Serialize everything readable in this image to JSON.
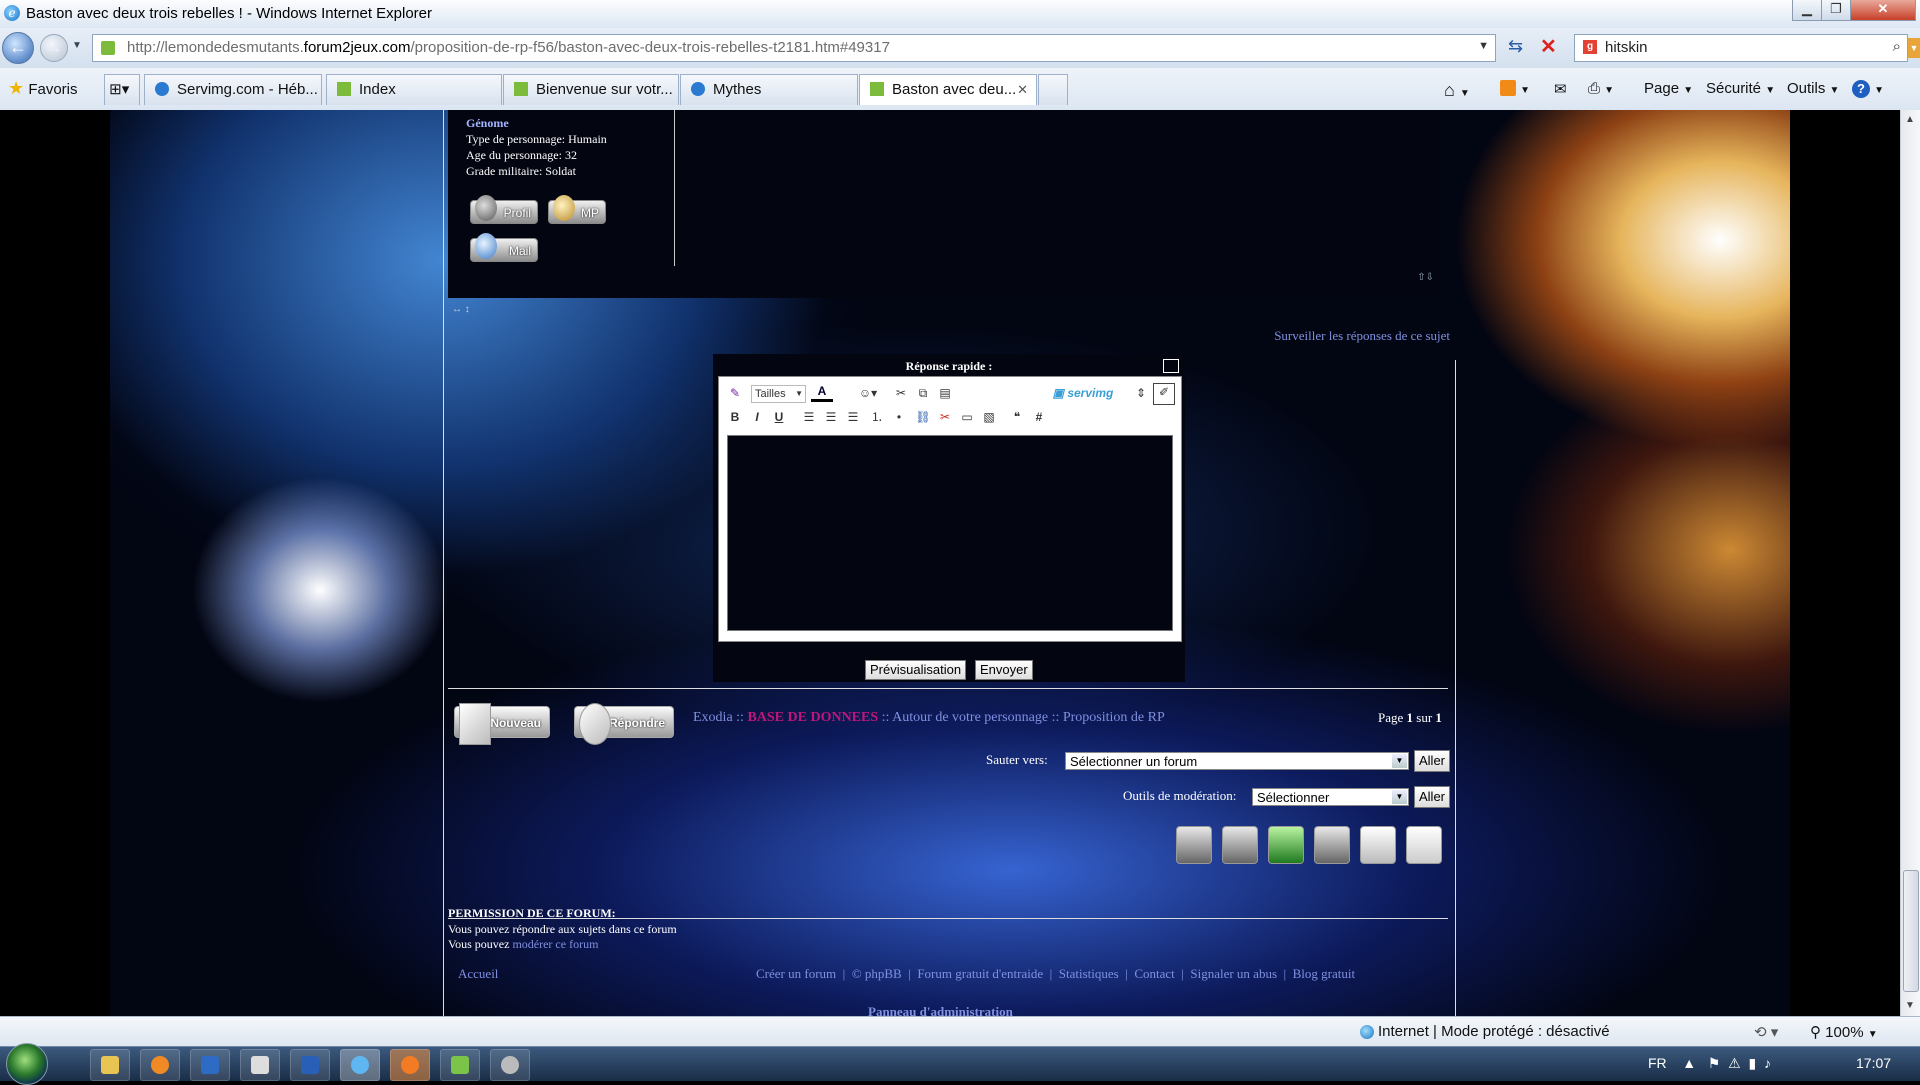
{
  "window": {
    "title": "Baston avec deux trois rebelles ! - Windows Internet Explorer"
  },
  "address": {
    "url_prefix": "http://lemondedesmutants.",
    "url_domain": "forum2jeux.com",
    "url_suffix": "/proposition-de-rp-f56/baston-avec-deux-trois-rebelles-t2181.htm#49317"
  },
  "search": {
    "value": "hitskin"
  },
  "favorites": {
    "label": "Favoris"
  },
  "tabs": [
    {
      "label": "Servimg.com - Héb...",
      "icon_color": "#2a7ad2"
    },
    {
      "label": "Index",
      "icon_color": "#7dbb3c"
    },
    {
      "label": "Bienvenue sur votr...",
      "icon_color": "#7dbb3c"
    },
    {
      "label": "Mythes",
      "icon_color": "#2a7ad2"
    },
    {
      "label": "Baston avec deu...",
      "icon_color": "#7dbb3c",
      "active": true
    }
  ],
  "toolbar": {
    "page": "Page",
    "security": "Sécurité",
    "tools": "Outils"
  },
  "post": {
    "field_name": "Génome",
    "type": "Type de personnage: Humain",
    "age": "Age du personnage: 32",
    "grade": "Grade militaire: Soldat",
    "btn_profile": "Profil",
    "btn_pm": "MP",
    "btn_mail": "Mail"
  },
  "watch_link": "Surveiller les réponses de ce sujet",
  "quick_reply": {
    "title": "Réponse rapide :",
    "size_label": "Tailles",
    "servimg": "servimg",
    "preview": "Prévisualisation",
    "send": "Envoyer"
  },
  "actions": {
    "new": "Nouveau",
    "reply": "Répondre"
  },
  "breadcrumb": {
    "items": [
      "Exodia",
      "BASE DE DONNEES",
      "Autour de votre personnage",
      "Proposition de RP"
    ],
    "separator": "::"
  },
  "pagination": {
    "prefix": "Page",
    "current": "1",
    "mid": "sur",
    "total": "1"
  },
  "jump": {
    "label": "Sauter vers:",
    "value": "Sélectionner un forum",
    "go": "Aller"
  },
  "moderation": {
    "label": "Outils de modération:",
    "value": "Sélectionner",
    "go": "Aller"
  },
  "permissions": {
    "title": "PERMISSION DE CE FORUM:",
    "line1": "Vous pouvez répondre aux sujets dans ce forum",
    "line2_prefix": "Vous pouvez",
    "line2_link": "modérer ce forum"
  },
  "footer": {
    "home": "Accueil",
    "links": [
      "Créer un forum",
      "© phpBB",
      "Forum gratuit d'entraide",
      "Statistiques",
      "Contact",
      "Signaler un abus",
      "Blog gratuit"
    ],
    "admin": "Panneau d'administration"
  },
  "statusbar": {
    "zone": "Internet | Mode protégé : désactivé",
    "zoom": "100%"
  },
  "taskbar": {
    "lang": "FR",
    "time": "17:07"
  }
}
